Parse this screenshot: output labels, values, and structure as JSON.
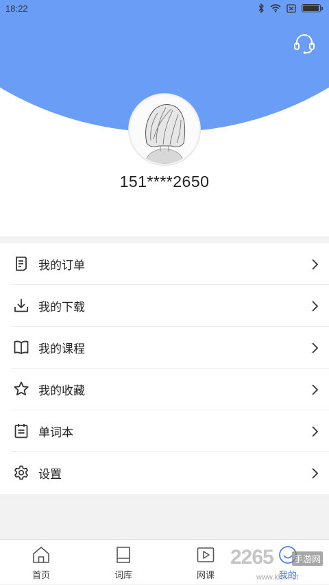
{
  "status_bar": {
    "time": "18:22",
    "battery_level": 0.95,
    "icons": [
      "bluetooth-icon",
      "wifi-icon",
      "sim-blocked-icon",
      "battery-icon"
    ]
  },
  "header": {
    "accent_color": "#6a9ef6",
    "support_icon": "headset-icon"
  },
  "profile": {
    "phone": "151****2650",
    "avatar_icon": "avatar-illustration"
  },
  "menu": {
    "items": [
      {
        "label": "我的订单",
        "icon": "order-icon"
      },
      {
        "label": "我的下载",
        "icon": "download-icon"
      },
      {
        "label": "我的课程",
        "icon": "book-icon"
      },
      {
        "label": "我的收藏",
        "icon": "star-icon"
      },
      {
        "label": "单词本",
        "icon": "notebook-icon"
      },
      {
        "label": "设置",
        "icon": "gear-icon"
      }
    ]
  },
  "tabbar": {
    "active_color": "#4a82ee",
    "tabs": [
      {
        "label": "首页",
        "icon": "home-icon"
      },
      {
        "label": "词库",
        "icon": "library-icon"
      },
      {
        "label": "网课",
        "icon": "play-icon"
      },
      {
        "label": "我的",
        "icon": "profile-icon",
        "active": true
      }
    ]
  },
  "watermark": {
    "text": "2265",
    "badge": "手游网",
    "url": "www.kkx.net"
  }
}
